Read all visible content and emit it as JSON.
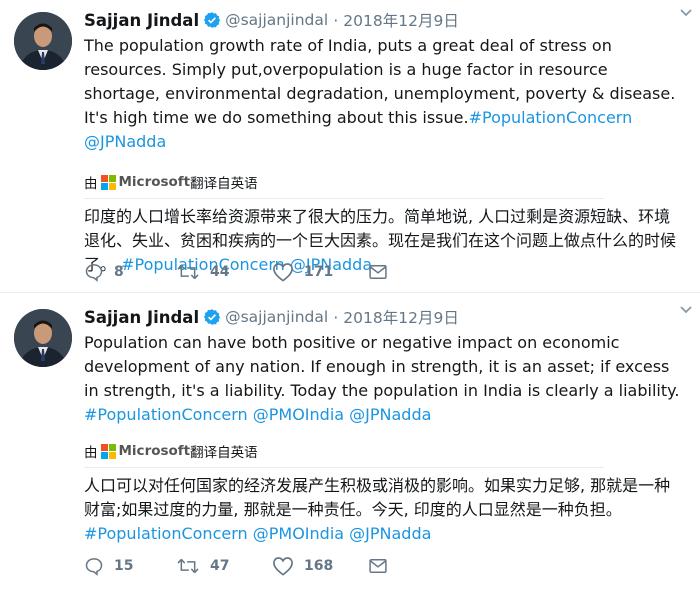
{
  "colors": {
    "link": "#1b95e0",
    "muted": "#657786",
    "text": "#14171a",
    "verified": "#1da1f2"
  },
  "tweets": [
    {
      "name": "Sajjan Jindal",
      "handle": "@sajjanjindal",
      "dot": "·",
      "time": "2018年12月9日",
      "text": "The population growth rate of India, puts a great deal of stress on resources. Simply put,overpopulation is a huge factor in resource shortage, environmental degradation, unemployment, poverty & disease. It's high time we do something about this issue.",
      "links": [
        "#PopulationConcern",
        "@JPNadda"
      ],
      "translated_prefix": "由",
      "translated_brand": "Microsoft",
      "translated_suffix": "翻译自英语",
      "translation": "印度的人口增长率给资源带来了很大的压力。简单地说, 人口过剩是资源短缺、环境退化、失业、贫困和疾病的一个巨大因素。现在是我们在这个问题上做点什么的时候了。",
      "translation_links": [
        "#PopulationConcern",
        "@JPNadda"
      ],
      "replies": "8",
      "retweets": "44",
      "likes": "171"
    },
    {
      "name": "Sajjan Jindal",
      "handle": "@sajjanjindal",
      "dot": "·",
      "time": "2018年12月9日",
      "text": "Population can have both positive or negative impact on economic development of any nation. If enough in strength, it is an asset; if excess in strength, it's a liability. Today the population in India is clearly a liability.",
      "links": [
        "#PopulationConcern",
        "@PMOIndia",
        "@JPNadda"
      ],
      "translated_prefix": "由",
      "translated_brand": "Microsoft",
      "translated_suffix": "翻译自英语",
      "translation": "人口可以对任何国家的经济发展产生积极或消极的影响。如果实力足够, 那就是一种财富;如果过度的力量, 那就是一种责任。今天, 印度的人口显然是一种负担。",
      "translation_links": [
        "#PopulationConcern",
        "@PMOIndia",
        "@JPNadda"
      ],
      "replies": "15",
      "retweets": "47",
      "likes": "168"
    }
  ]
}
